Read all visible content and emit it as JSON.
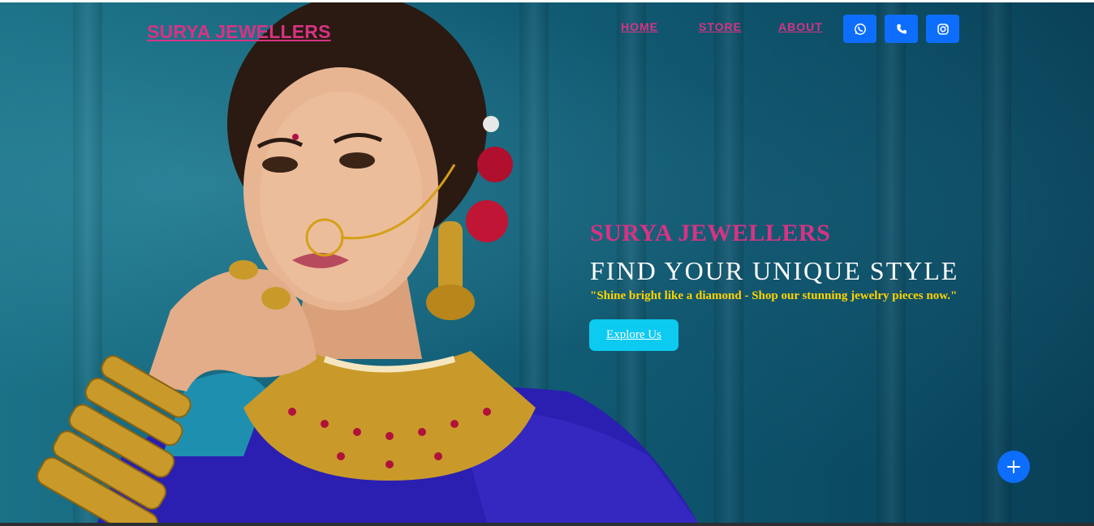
{
  "header": {
    "brand": "SURYA JEWELLERS",
    "nav": [
      {
        "label": "HOME"
      },
      {
        "label": "STORE"
      },
      {
        "label": "ABOUT"
      }
    ],
    "social": [
      {
        "icon": "whatsapp-icon"
      },
      {
        "icon": "phone-icon"
      },
      {
        "icon": "instagram-icon"
      }
    ]
  },
  "hero": {
    "title": "SURYA JEWELLERS",
    "subtitle": "FIND YOUR UNIQUE STYLE",
    "tagline": "\"Shine bright like a diamond - Shop our stunning jewelry pieces now.\"",
    "cta_label": "Explore Us"
  },
  "fab": {
    "icon": "plus-icon"
  },
  "colors": {
    "brand_pink": "#d63384",
    "primary_blue": "#0d6efd",
    "cta_cyan": "#0dcaf0",
    "tagline_yellow": "#ffd400",
    "hero_teal": "#0f5a72"
  }
}
